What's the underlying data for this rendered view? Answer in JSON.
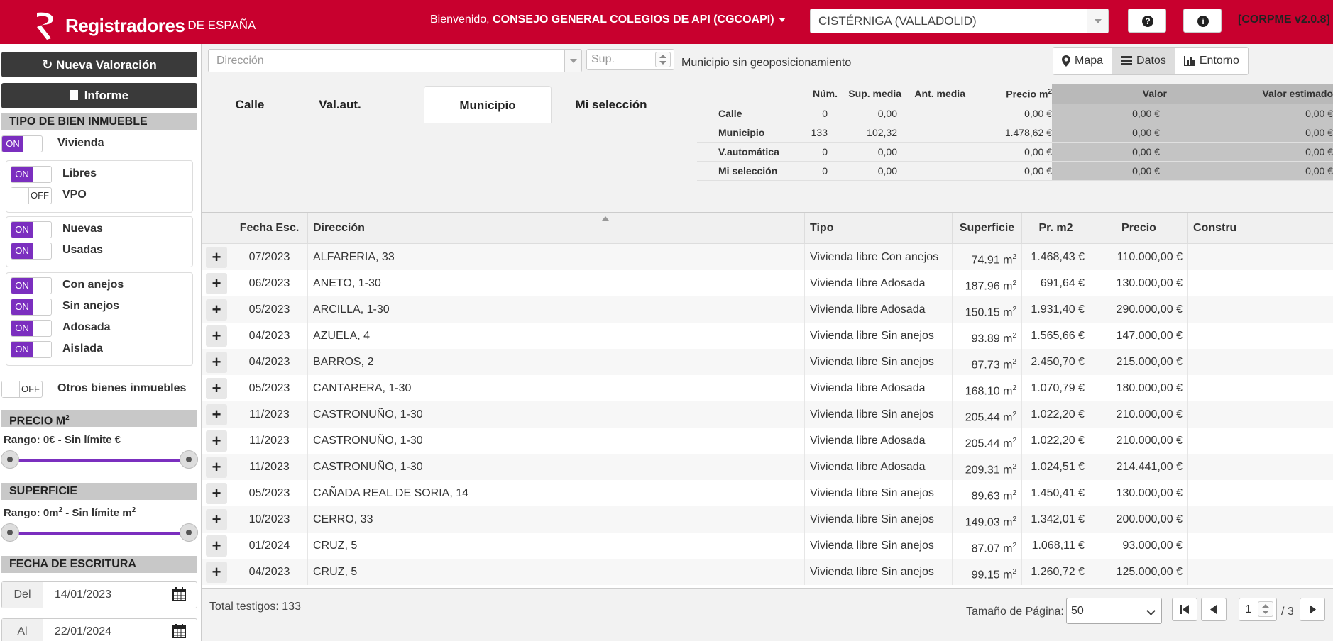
{
  "header": {
    "brand": "Registradores",
    "brand_sub": "DE ESPAÑA",
    "welcome_prefix": "Bienvenido, ",
    "user": "CONSEJO GENERAL COLEGIOS DE API (CGCOAPI)",
    "municipality": "CISTÉRNIGA (VALLADOLID)",
    "help_icon": "?",
    "info_icon": "i",
    "version": "[CORPME v2.0.8]",
    "brand_color": "#c8002e"
  },
  "sidebar": {
    "new_valuation": "Nueva Valoración",
    "report": "Informe",
    "property_type_title": "TIPO DE BIEN INMUEBLE",
    "vivienda": {
      "label": "Vivienda",
      "state": "ON"
    },
    "libres": {
      "label": "Libres",
      "state": "ON"
    },
    "vpo": {
      "label": "VPO",
      "state": "OFF"
    },
    "nuevas": {
      "label": "Nuevas",
      "state": "ON"
    },
    "usadas": {
      "label": "Usadas",
      "state": "ON"
    },
    "con_anejos": {
      "label": "Con anejos",
      "state": "ON"
    },
    "sin_anejos": {
      "label": "Sin anejos",
      "state": "ON"
    },
    "adosada": {
      "label": "Adosada",
      "state": "ON"
    },
    "aislada": {
      "label": "Aislada",
      "state": "ON"
    },
    "otros": {
      "label": "Otros bienes inmuebles",
      "state": "OFF"
    },
    "price_title": "PRECIO M",
    "price_range": "Rango: 0€ - Sin límite €",
    "surface_title": "SUPERFICIE",
    "surface_range_prefix": "Rango: 0m",
    "surface_range_mid": " - Sin límite m",
    "sq": "2",
    "date_title": "FECHA DE ESCRITURA",
    "from_label": "Del",
    "from_value": "14/01/2023",
    "to_label": "Al",
    "to_value": "22/01/2024",
    "accent_color": "#7b2fbf"
  },
  "toolbar": {
    "address_placeholder": "Dirección",
    "surface_placeholder": "Sup.",
    "geo_status": "Municipio sin geoposicionamiento",
    "views": [
      "Mapa",
      "Datos",
      "Entorno"
    ],
    "active_view": "Datos"
  },
  "tabs": [
    "Calle",
    "Val.aut.",
    "Municipio",
    "Mi selección"
  ],
  "active_tab": "Municipio",
  "stats": {
    "headers": [
      "",
      "Núm.",
      "Sup. media",
      "Ant. media",
      "Precio m",
      "Valor",
      "Valor estimado"
    ],
    "rows": [
      [
        "Calle",
        "0",
        "0,00",
        "",
        "0,00 €",
        "0,00 €",
        "0,00 €"
      ],
      [
        "Municipio",
        "133",
        "102,32",
        "",
        "1.478,62 €",
        "0,00 €",
        "0,00 €"
      ],
      [
        "V.automática",
        "0",
        "0,00",
        "",
        "0,00 €",
        "0,00 €",
        "0,00 €"
      ],
      [
        "Mi selección",
        "0",
        "0,00",
        "",
        "0,00 €",
        "0,00 €",
        "0,00 €"
      ]
    ]
  },
  "grid": {
    "headers": [
      "Fecha Esc.",
      "Dirección",
      "Tipo",
      "Superficie",
      "Pr. m2",
      "Precio",
      "Constru"
    ],
    "expand_label": "+",
    "surface_unit": "m",
    "rows": [
      [
        "07/2023",
        "ALFARERIA, 33",
        "Vivienda libre Con anejos",
        "74.91",
        "1.468,43 €",
        "110.000,00 €"
      ],
      [
        "06/2023",
        "ANETO, 1-30",
        "Vivienda libre Adosada",
        "187.96",
        "691,64 €",
        "130.000,00 €"
      ],
      [
        "05/2023",
        "ARCILLA, 1-30",
        "Vivienda libre Adosada",
        "150.15",
        "1.931,40 €",
        "290.000,00 €"
      ],
      [
        "04/2023",
        "AZUELA, 4",
        "Vivienda libre Sin anejos",
        "93.89",
        "1.565,66 €",
        "147.000,00 €"
      ],
      [
        "04/2023",
        "BARROS, 2",
        "Vivienda libre Sin anejos",
        "87.73",
        "2.450,70 €",
        "215.000,00 €"
      ],
      [
        "05/2023",
        "CANTARERA, 1-30",
        "Vivienda libre Adosada",
        "168.10",
        "1.070,79 €",
        "180.000,00 €"
      ],
      [
        "11/2023",
        "CASTRONUÑO, 1-30",
        "Vivienda libre Sin anejos",
        "205.44",
        "1.022,20 €",
        "210.000,00 €"
      ],
      [
        "11/2023",
        "CASTRONUÑO, 1-30",
        "Vivienda libre Adosada",
        "205.44",
        "1.022,20 €",
        "210.000,00 €"
      ],
      [
        "11/2023",
        "CASTRONUÑO, 1-30",
        "Vivienda libre Adosada",
        "209.31",
        "1.024,51 €",
        "214.441,00 €"
      ],
      [
        "05/2023",
        "CAÑADA REAL DE SORIA, 14",
        "Vivienda libre Sin anejos",
        "89.63",
        "1.450,41 €",
        "130.000,00 €"
      ],
      [
        "10/2023",
        "CERRO, 33",
        "Vivienda libre Sin anejos",
        "149.03",
        "1.342,01 €",
        "200.000,00 €"
      ],
      [
        "01/2024",
        "CRUZ, 5",
        "Vivienda libre Sin anejos",
        "87.07",
        "1.068,11 €",
        "93.000,00 €"
      ],
      [
        "04/2023",
        "CRUZ, 5",
        "Vivienda libre Sin anejos",
        "99.15",
        "1.260,72 €",
        "125.000,00 €"
      ]
    ]
  },
  "footer": {
    "total": "Total testigos: 133",
    "page_size_label": "Tamaño de Página:",
    "page_size": "50",
    "current_page": "1",
    "total_pages": "/ 3"
  }
}
